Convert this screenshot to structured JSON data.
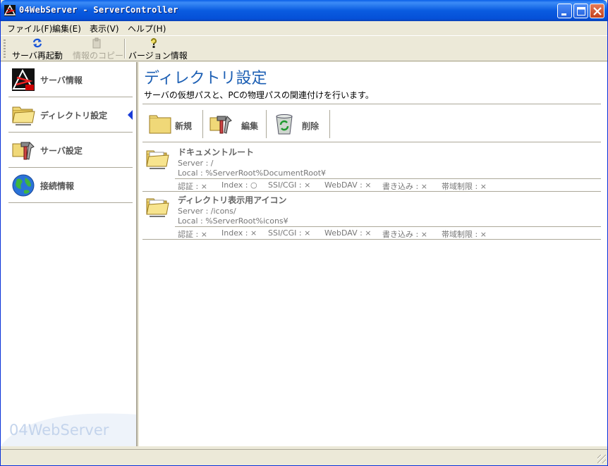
{
  "window": {
    "title": "04WebServer - ServerController"
  },
  "menu": [
    {
      "label": "ファイル(F)"
    },
    {
      "label": "編集(E)"
    },
    {
      "label": "表示(V)"
    },
    {
      "label": "ヘルプ(H)"
    }
  ],
  "toolbar": {
    "restart_label": "サーバ再起動",
    "copy_info_label": "情報のコピー",
    "version_label": "バージョン情報"
  },
  "sidebar": {
    "items": [
      {
        "label": "サーバ情報"
      },
      {
        "label": "ディレクトリ設定"
      },
      {
        "label": "サーバ設定"
      },
      {
        "label": "接続情報"
      }
    ],
    "watermark": "04WebServer"
  },
  "main": {
    "title": "ディレクトリ設定",
    "description": "サーバの仮想パスと、PCの物理パスの関連付けを行います。",
    "actions": {
      "new_label": "新規",
      "edit_label": "編集",
      "delete_label": "削除"
    },
    "entries": [
      {
        "name": "ドキュメントルート",
        "server": "Server : /",
        "local": "Local : %ServerRoot%DocumentRoot¥",
        "auth": "認証 : ×",
        "index": "Index : ○",
        "cgi": "SSI/CGI : ×",
        "webdav": "WebDAV : ×",
        "write": "書き込み : ×",
        "bandwidth": "帯域制限 : ×"
      },
      {
        "name": "ディレクトリ表示用アイコン",
        "server": "Server : /icons/",
        "local": "Local : %ServerRoot%icons¥",
        "auth": "認証 : ×",
        "index": "Index : ×",
        "cgi": "SSI/CGI : ×",
        "webdav": "WebDAV : ×",
        "write": "書き込み : ×",
        "bandwidth": "帯域制限 : ×"
      }
    ]
  },
  "colors": {
    "title_bar": "#0a5ce0",
    "accent_title": "#1c5fb4",
    "selection_arrow": "#1a3cd8"
  },
  "icons": {
    "app": "04webserver-logo-icon",
    "restart": "refresh-icon",
    "copy": "clipboard-icon",
    "version": "question-bulb-icon",
    "folder": "folder-icon",
    "tools": "tools-icon",
    "globe": "globe-icon",
    "recycle": "recycle-bin-icon"
  }
}
